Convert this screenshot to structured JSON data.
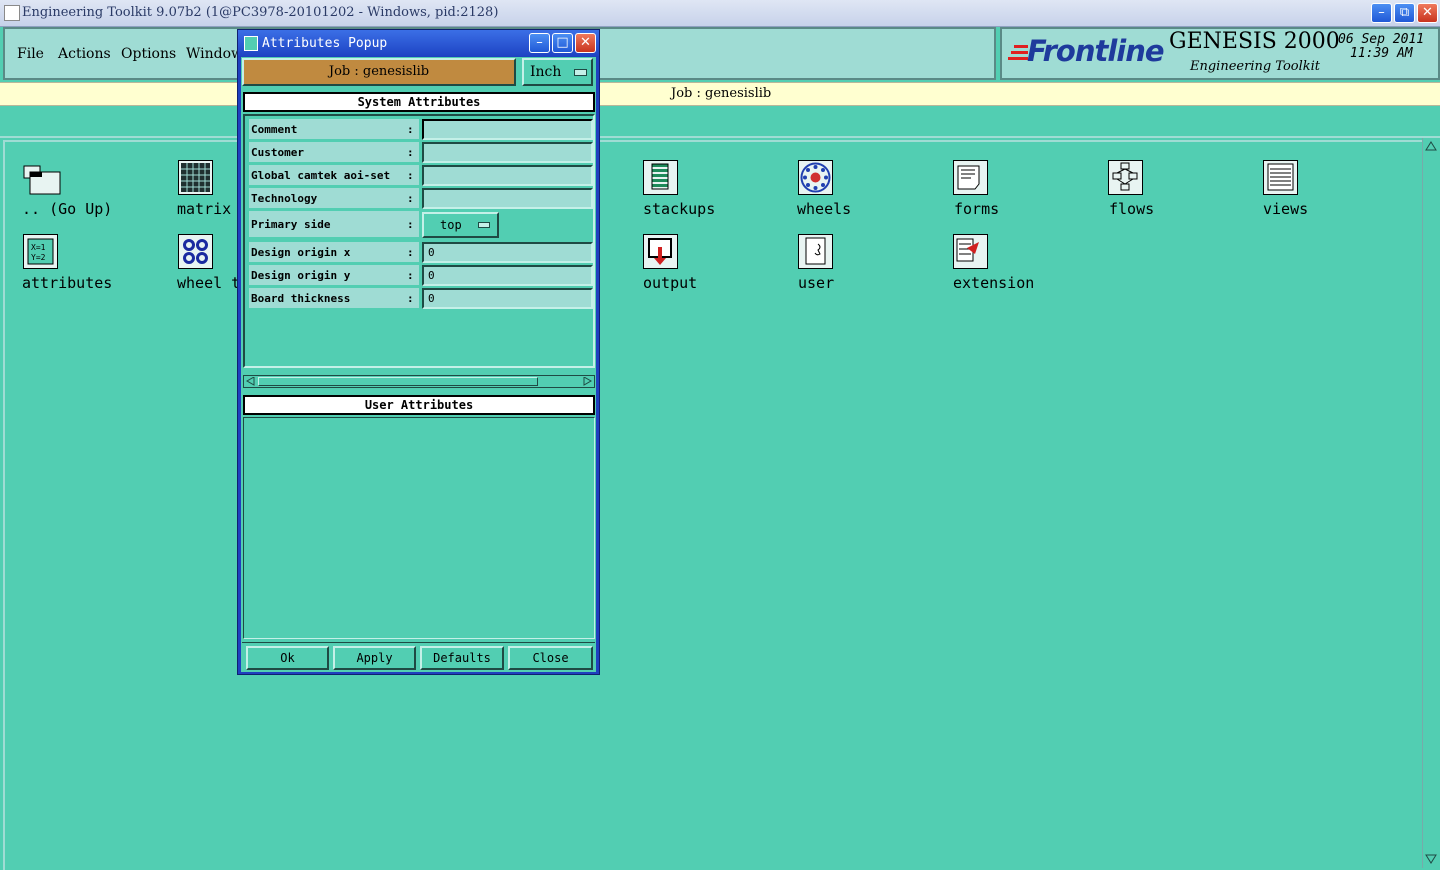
{
  "window": {
    "title": "Engineering Toolkit 9.07b2 (1@PC3978-20101202 - Windows, pid:2128)",
    "min_icon": "minimize-icon",
    "max_icon": "restore-icon",
    "close_icon": "close-icon"
  },
  "menu": {
    "file": "File",
    "actions": "Actions",
    "options": "Options",
    "window": "Window"
  },
  "logo": {
    "brand": "Frontline",
    "product": "GENESIS 2000",
    "subtitle": "Engineering Toolkit",
    "date": "06 Sep 2011",
    "time": "11:39 AM"
  },
  "job_bar": {
    "text": "Job : genesislib"
  },
  "icons": [
    {
      "id": "go-up",
      "label": ".. (Go Up)",
      "icon": "folder-up-icon"
    },
    {
      "id": "matrix",
      "label": "matrix",
      "icon": "matrix-grid-icon"
    },
    {
      "id": "stackups",
      "label": "stackups",
      "icon": "stackup-icon"
    },
    {
      "id": "wheels",
      "label": "wheels",
      "icon": "wheel-icon"
    },
    {
      "id": "forms",
      "label": "forms",
      "icon": "form-icon"
    },
    {
      "id": "flows",
      "label": "flows",
      "icon": "flow-icon"
    },
    {
      "id": "views",
      "label": "views",
      "icon": "view-list-icon"
    },
    {
      "id": "attributes",
      "label": "attributes",
      "icon": "attributes-icon"
    },
    {
      "id": "wheel-templates",
      "label": "wheel t",
      "icon": "wheel-template-icon"
    },
    {
      "id": "output",
      "label": "output",
      "icon": "output-icon"
    },
    {
      "id": "user",
      "label": "user",
      "icon": "user-icon"
    },
    {
      "id": "extension",
      "label": "extension",
      "icon": "extension-icon"
    }
  ],
  "popup": {
    "title": "Attributes Popup",
    "job_label": "Job : genesislib",
    "units": "Inch",
    "system_header": "System Attributes",
    "user_header": "User Attributes",
    "rows": [
      {
        "label": "Comment",
        "value": ""
      },
      {
        "label": "Customer",
        "value": ""
      },
      {
        "label": "Global camtek aoi-set",
        "value": ""
      },
      {
        "label": "Technology",
        "value": ""
      },
      {
        "label": "Primary side",
        "value": "top"
      },
      {
        "label": "Design origin x",
        "value": "0"
      },
      {
        "label": "Design origin y",
        "value": "0"
      },
      {
        "label": "Board thickness",
        "value": "0"
      }
    ],
    "buttons": {
      "ok": "Ok",
      "apply": "Apply",
      "defaults": "Defaults",
      "close": "Close"
    }
  },
  "colors": {
    "background": "#52ceb2",
    "panel": "#9fdcd4",
    "job_button": "#c08a40",
    "job_bar": "#ffffd0",
    "popup_frame": "#1f3fbf",
    "brand_blue": "#1e3a9c"
  }
}
